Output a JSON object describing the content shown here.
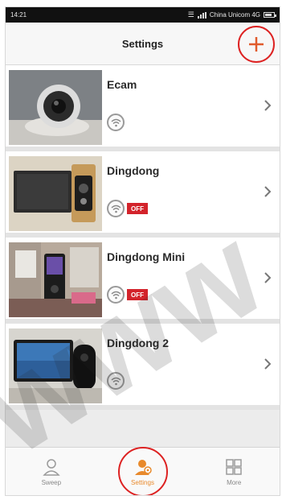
{
  "status_bar": {
    "time": "14:21",
    "carrier": "China Unicom 4G"
  },
  "header": {
    "title": "Settings",
    "add_icon": "plus-icon"
  },
  "devices": [
    {
      "name": "Ecam",
      "tag": ""
    },
    {
      "name": "Dingdong",
      "tag": "OFF"
    },
    {
      "name": "Dingdong Mini",
      "tag": "OFF"
    },
    {
      "name": "Dingdong 2",
      "tag": ""
    }
  ],
  "tabs": [
    {
      "label": "Sweep",
      "icon": "person-icon"
    },
    {
      "label": "Settings",
      "icon": "gear-person-icon"
    },
    {
      "label": "More",
      "icon": "grid-icon"
    }
  ],
  "colors": {
    "accent": "#e8892b",
    "highlight_circle": "#d22222",
    "tag_red": "#d3232b"
  },
  "watermark": {
    "text": "www"
  }
}
